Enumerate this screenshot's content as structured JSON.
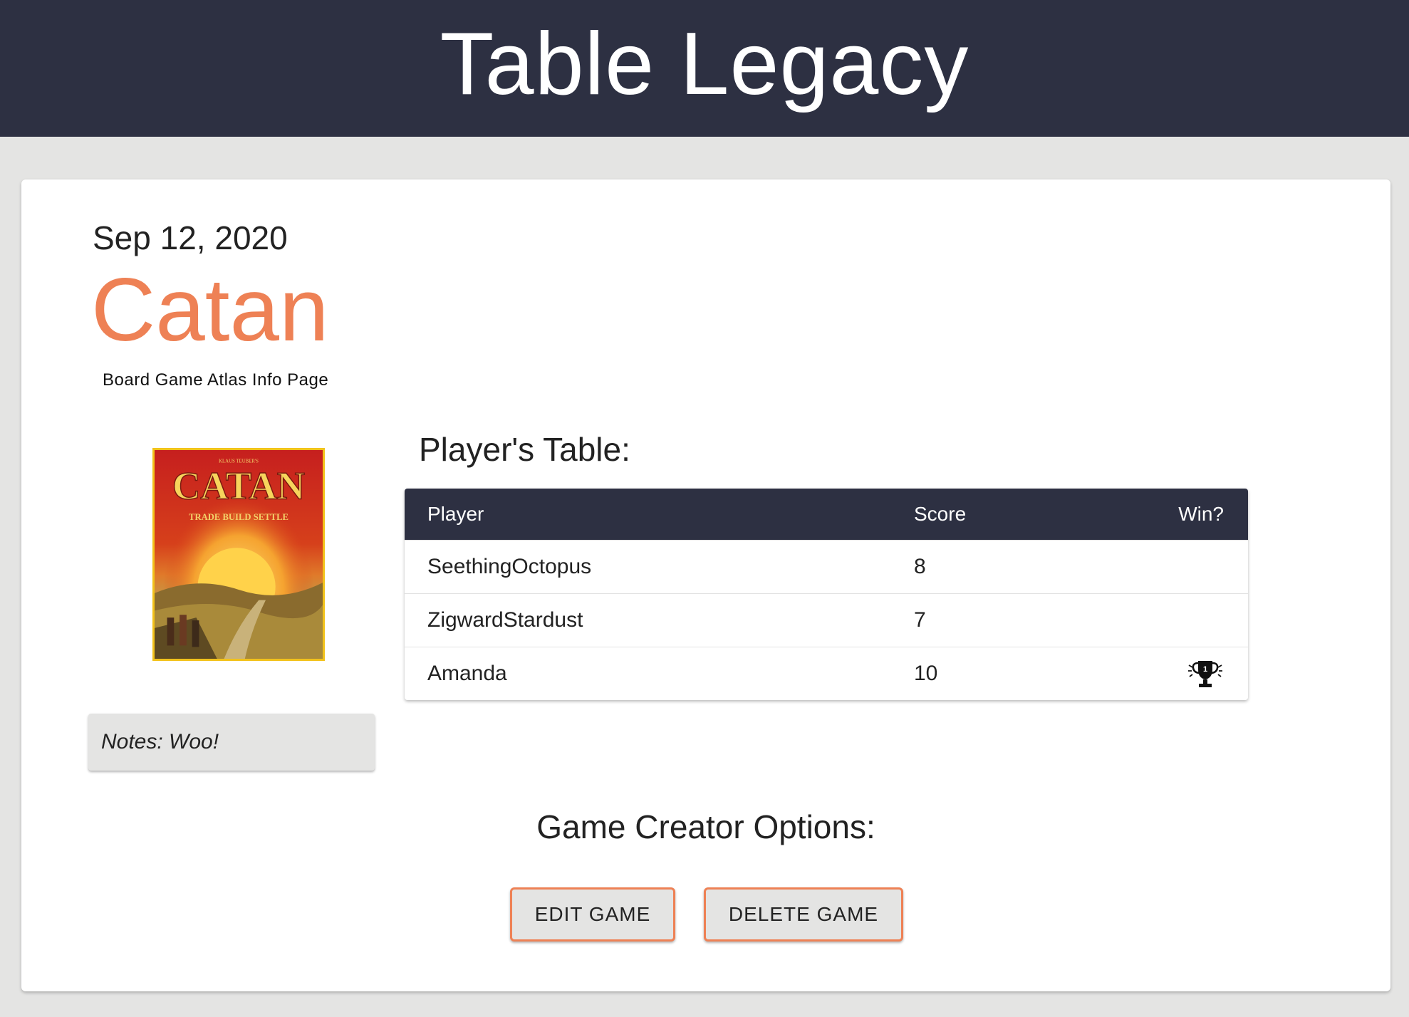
{
  "app": {
    "title": "Table Legacy"
  },
  "game": {
    "date": "Sep 12, 2020",
    "name": "Catan",
    "atlas_link": "Board Game Atlas Info Page",
    "box_art": {
      "title": "CATAN",
      "tagline": "TRADE BUILD SETTLE",
      "author": "KLAUS TEUBER'S"
    },
    "notes": "Notes: Woo!"
  },
  "players": {
    "title": "Player's Table:",
    "columns": [
      "Player",
      "Score",
      "Win?"
    ],
    "rows": [
      {
        "player": "SeethingOctopus",
        "score": "8",
        "win": false
      },
      {
        "player": "ZigwardStardust",
        "score": "7",
        "win": false
      },
      {
        "player": "Amanda",
        "score": "10",
        "win": true,
        "win_icon": "trophy-icon",
        "trophy_rank": "1"
      }
    ]
  },
  "options": {
    "title": "Game Creator Options:",
    "edit_label": "EDIT GAME",
    "delete_label": "DELETE GAME"
  },
  "colors": {
    "header_bg": "#2d3042",
    "accent": "#ee8155",
    "page_bg": "#e4e4e3"
  }
}
